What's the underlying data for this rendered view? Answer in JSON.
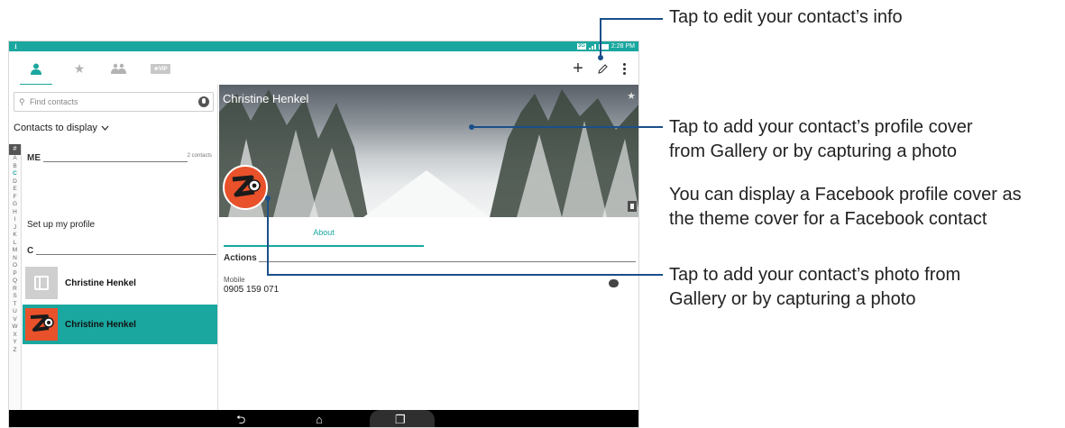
{
  "status_bar": {
    "network": "3G",
    "time": "2:28 PM"
  },
  "tabs": [
    {
      "icon": "person-icon",
      "active": true
    },
    {
      "icon": "star-icon",
      "active": false
    },
    {
      "icon": "group-icon",
      "active": false
    },
    {
      "label": "★VIP",
      "icon": "vip-icon",
      "active": false
    }
  ],
  "toolbar": {
    "add_label": "+",
    "edit_icon": "pencil-icon",
    "menu_icon": "overflow-menu-icon"
  },
  "search": {
    "placeholder": "Find contacts"
  },
  "filter": {
    "label": "Contacts to display"
  },
  "index": {
    "hash": "#",
    "letters": [
      "A",
      "B",
      "C",
      "D",
      "E",
      "F",
      "G",
      "H",
      "I",
      "J",
      "K",
      "L",
      "M",
      "N",
      "O",
      "P",
      "Q",
      "R",
      "S",
      "T",
      "U",
      "V",
      "W",
      "X",
      "Y",
      "Z"
    ],
    "highlight": "C"
  },
  "sections": {
    "me": {
      "label": "ME",
      "count": "2 contacts"
    },
    "setup": "Set up my profile",
    "c": {
      "label": "C"
    }
  },
  "contacts": [
    {
      "name": "Christine Henkel",
      "selected": false
    },
    {
      "name": "Christine Henkel",
      "selected": true
    }
  ],
  "detail": {
    "name": "Christine Henkel",
    "tab": "About",
    "actions_label": "Actions",
    "mobile_label": "Mobile",
    "mobile_number": "0905 159 071"
  },
  "callouts": {
    "edit": "Tap to edit your contact’s info",
    "cover_line1": "Tap to add your contact’s profile cover",
    "cover_line2": "from Gallery or by capturing a photo",
    "facebook_line1": "You can display a Facebook profile cover as",
    "facebook_line2": "the theme cover for a Facebook contact",
    "photo_line1": "Tap to add your contact’s photo from",
    "photo_line2": "Gallery or by capturing a photo"
  },
  "colors": {
    "accent": "#1aa79f",
    "callout_line": "#1a4f8a",
    "photo_orange": "#e8512a"
  }
}
